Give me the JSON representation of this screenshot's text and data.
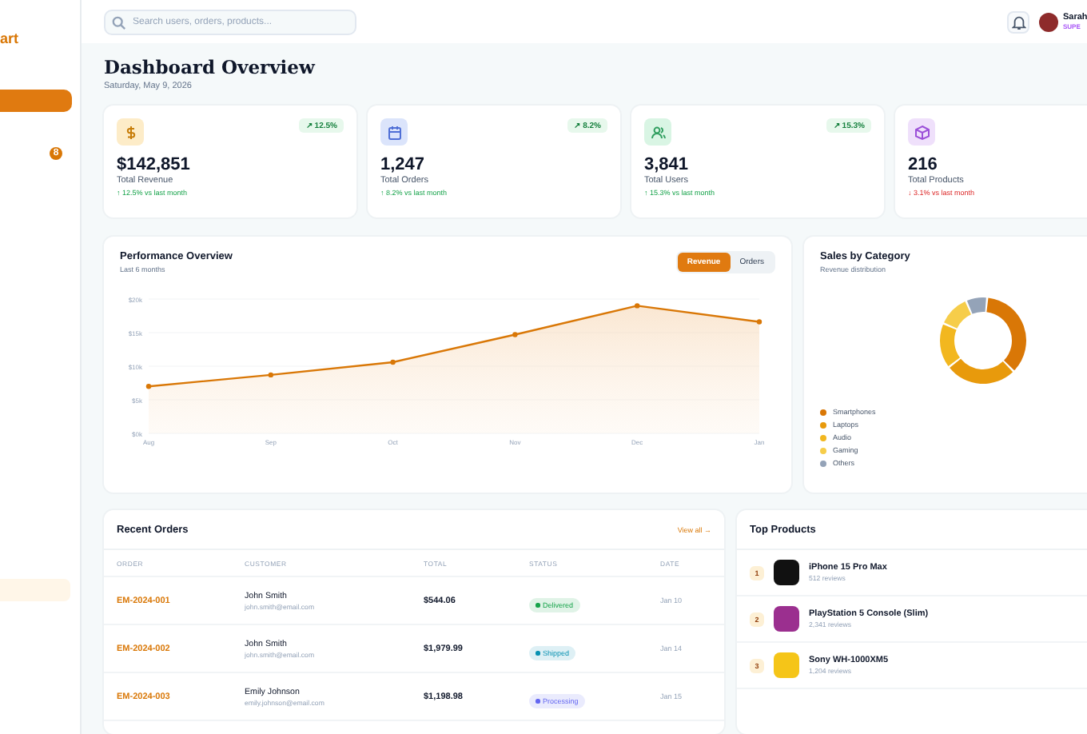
{
  "sidebar": {
    "logo": "art",
    "active_item": {
      "selected": true
    },
    "badge": "8"
  },
  "header": {
    "search": {
      "placeholder": "Search users, orders, products..."
    },
    "user": {
      "name": "Sarah",
      "role": "SUPE"
    }
  },
  "page": {
    "title": "Dashboard Overview",
    "date": "Saturday, May 9, 2026"
  },
  "stats": [
    {
      "kind": "dollar",
      "value": "$142,851",
      "label": "Total Revenue",
      "badge": "↗ 12.5%",
      "change": "↑ 12.5% vs last month",
      "negative": false
    },
    {
      "kind": "calendar",
      "value": "1,247",
      "label": "Total Orders",
      "badge": "↗ 8.2%",
      "change": "↑ 8.2% vs last month",
      "negative": false
    },
    {
      "kind": "users",
      "value": "3,841",
      "label": "Total Users",
      "badge": "↗ 15.3%",
      "change": "↑ 15.3% vs last month",
      "negative": false
    },
    {
      "kind": "cube",
      "value": "216",
      "label": "Total Products",
      "change": "↓ 3.1% vs last month",
      "negative": true
    }
  ],
  "performance": {
    "title": "Performance Overview",
    "subtitle": "Last 6 months",
    "toggle": [
      {
        "label": "Revenue",
        "selected": true
      },
      {
        "label": "Orders",
        "selected": false
      }
    ],
    "chart_data": {
      "type": "area",
      "categories": [
        "Aug",
        "Sep",
        "Oct",
        "Nov",
        "Dec",
        "Jan"
      ],
      "series": [
        {
          "color": "#d97706",
          "values": [
            7.0,
            8.7,
            10.6,
            14.7,
            19.0,
            16.6
          ]
        }
      ],
      "ylim": [
        0,
        20
      ],
      "yticks": [
        {
          "value": 0,
          "label": "$0k"
        },
        {
          "value": 5,
          "label": "$5k"
        },
        {
          "value": 10,
          "label": "$10k"
        },
        {
          "value": 15,
          "label": "$15k"
        },
        {
          "value": 20,
          "label": "$20k"
        }
      ]
    }
  },
  "sales": {
    "title": "Sales by Category",
    "subtitle": "Revenue distribution",
    "legend": [
      {
        "label": "Smartphones",
        "color": "#d97706"
      },
      {
        "label": "Laptops",
        "color": "#e89a0c"
      },
      {
        "label": "Audio",
        "color": "#f2b71f"
      },
      {
        "label": "Gaming",
        "color": "#f6cd4a"
      },
      {
        "label": "Others",
        "color": "#94a3b8"
      }
    ]
  },
  "orders": {
    "title": "Recent Orders",
    "view_all": "View all →",
    "columns": [
      "ORDER",
      "CUSTOMER",
      "TOTAL",
      "STATUS",
      "DATE"
    ],
    "rows": [
      {
        "id": "EM-2024-001",
        "name": "John Smith",
        "email": "john.smith@email.com",
        "total": "$544.06",
        "status": "Delivered",
        "color": "#16a34a",
        "date": "Jan 10"
      },
      {
        "id": "EM-2024-002",
        "name": "John Smith",
        "email": "john.smith@email.com",
        "total": "$1,979.99",
        "status": "Shipped",
        "color": "#0891b2",
        "date": "Jan 14"
      },
      {
        "id": "EM-2024-003",
        "name": "Emily Johnson",
        "email": "emily.johnson@email.com",
        "total": "$1,198.98",
        "status": "Processing",
        "color": "#6366f1",
        "date": "Jan 15"
      }
    ]
  },
  "products": {
    "title": "Top Products",
    "items": [
      {
        "rank": "1",
        "name": "iPhone 15 Pro Max",
        "reviews": "512 reviews",
        "color": "#111111"
      },
      {
        "rank": "2",
        "name": "PlayStation 5 Console (Slim)",
        "reviews": "2,341 reviews",
        "color": "#9b2f8f"
      },
      {
        "rank": "3",
        "name": "Sony WH-1000XM5",
        "reviews": "1,204 reviews",
        "color": "#f5c518"
      }
    ]
  }
}
